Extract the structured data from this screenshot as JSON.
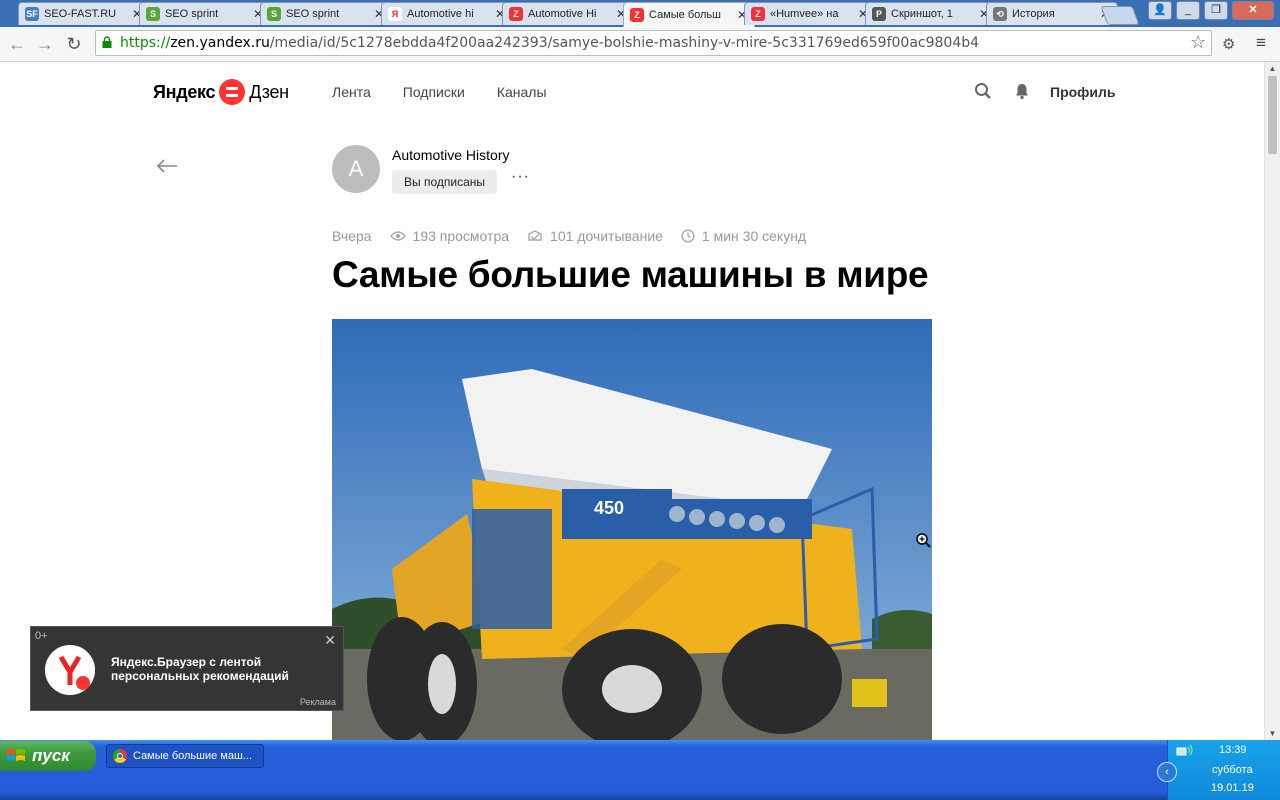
{
  "browser": {
    "tabs": [
      {
        "label": "SEO-FAST.RU",
        "icon": "sf-icon",
        "color": "#4b7bbf",
        "glyph": "SF",
        "active": false
      },
      {
        "label": "SEO sprint",
        "icon": "seosprint-icon",
        "color": "#5aa53a",
        "glyph": "S",
        "active": false
      },
      {
        "label": "SEO sprint",
        "icon": "seosprint-icon",
        "color": "#5aa53a",
        "glyph": "S",
        "active": false
      },
      {
        "label": "Automotive hi",
        "icon": "yandex-icon",
        "color": "#ffffff",
        "glyph": "Я",
        "active": false
      },
      {
        "label": "Automotive Hi",
        "icon": "zen-icon",
        "color": "#f33333",
        "glyph": "Z",
        "active": false
      },
      {
        "label": "Самые больш",
        "icon": "zen-icon",
        "color": "#f33333",
        "glyph": "Z",
        "active": true
      },
      {
        "label": "«Humvee» на",
        "icon": "zen-icon",
        "color": "#f33333",
        "glyph": "Z",
        "active": false
      },
      {
        "label": "Скриншот, 1",
        "icon": "p-icon",
        "color": "#555555",
        "glyph": "P",
        "active": false
      },
      {
        "label": "История",
        "icon": "history-icon",
        "color": "#777777",
        "glyph": "⟲",
        "active": false
      }
    ],
    "url": {
      "scheme": "https://",
      "host": "zen.yandex.ru",
      "path": "/media/id/5c1278ebdda4f200aa242393/samye-bolshie-mashiny-v-mire-5c331769ed659f00ac9804b4"
    }
  },
  "header": {
    "logo_yandex": "Яндекс",
    "logo_zen": "Дзен",
    "nav": [
      "Лента",
      "Подписки",
      "Каналы"
    ],
    "profile": "Профиль"
  },
  "channel": {
    "avatar_letter": "A",
    "name": "Automotive History",
    "subscribed": "Вы подписаны",
    "more": "···"
  },
  "article": {
    "date": "Вчера",
    "views": "193 просмотра",
    "reads": "101 дочитывание",
    "read_time": "1 мин 30 секунд",
    "title": "Самые большие машины в мире",
    "truck_badge": "450"
  },
  "notification": {
    "age": "0+",
    "text": "Яндекс.Браузер с лентой персональных рекомендаций",
    "ad": "Реклама"
  },
  "taskbar": {
    "start": "пуск",
    "window": "Самые большие маш...",
    "time": "13:39",
    "day": "суббота",
    "date": "19.01.19"
  },
  "colors": {
    "accent": "#ff3333",
    "taskbar": "#245edb",
    "start": "#3c9b3c"
  }
}
